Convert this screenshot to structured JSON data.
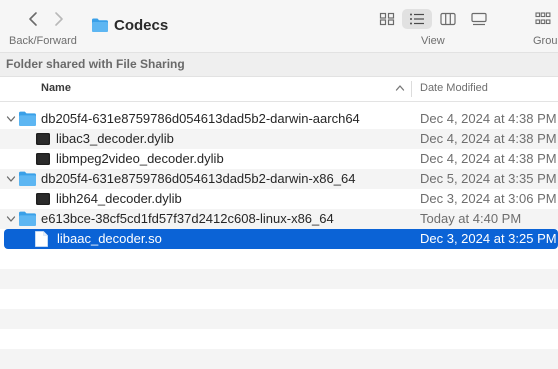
{
  "toolbar": {
    "back_forward_label": "Back/Forward",
    "title": "Codecs",
    "view_label": "View",
    "group_label": "Grou"
  },
  "pathbar": {
    "text": "Folder shared with File Sharing"
  },
  "columns": {
    "name": "Name",
    "date_modified": "Date Modified"
  },
  "rows": [
    {
      "name": "db205f4-631e8759786d054613dad5b2-darwin-aarch64",
      "date": "Dec 4, 2024 at 4:38 PM",
      "kind": "folder",
      "expanded": true
    },
    {
      "name": "libac3_decoder.dylib",
      "date": "Dec 4, 2024 at 4:38 PM",
      "kind": "exec"
    },
    {
      "name": "libmpeg2video_decoder.dylib",
      "date": "Dec 4, 2024 at 4:38 PM",
      "kind": "exec"
    },
    {
      "name": "db205f4-631e8759786d054613dad5b2-darwin-x86_64",
      "date": "Dec 5, 2024 at 3:35 PM",
      "kind": "folder",
      "expanded": true
    },
    {
      "name": "libh264_decoder.dylib",
      "date": "Dec 3, 2024 at 3:06 PM",
      "kind": "exec"
    },
    {
      "name": "e613bce-38cf5cd1fd57f37d2412c608-linux-x86_64",
      "date": "Today at 4:40 PM",
      "kind": "folder",
      "expanded": true
    },
    {
      "name": "libaac_decoder.so",
      "date": "Dec 3, 2024 at 3:25 PM",
      "kind": "document",
      "selected": true
    }
  ],
  "colors": {
    "selection": "#0b63d6",
    "folder": "#3aa0e8",
    "alt_row": "#f4f4f4"
  }
}
